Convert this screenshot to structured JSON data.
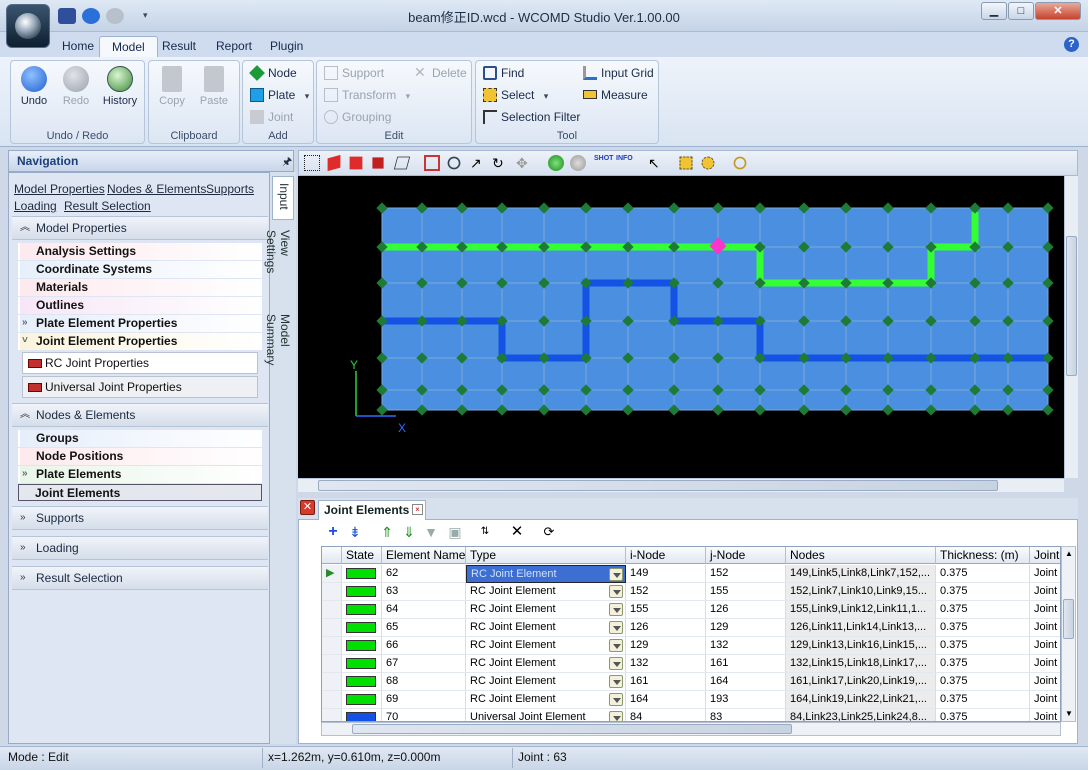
{
  "window": {
    "title": "beam修正ID.wcd - WCOMD Studio Ver.1.00.00",
    "controls": {
      "minimize": "▁",
      "maximize": "□",
      "close": "✕"
    }
  },
  "ribbon": {
    "tabs": [
      "Home",
      "Model",
      "Result",
      "Report",
      "Plugin"
    ],
    "active_tab": "Model",
    "groups": {
      "undo_redo": {
        "label": "Undo / Redo",
        "undo": "Undo",
        "redo": "Redo",
        "history": "History"
      },
      "clipboard": {
        "label": "Clipboard",
        "copy": "Copy",
        "paste": "Paste"
      },
      "add": {
        "label": "Add",
        "node": "Node",
        "plate": "Plate",
        "joint": "Joint"
      },
      "edit": {
        "label": "Edit",
        "support": "Support",
        "delete": "Delete",
        "transform": "Transform",
        "grouping": "Grouping"
      },
      "tool": {
        "label": "Tool",
        "find": "Find",
        "input_grid": "Input Grid",
        "select": "Select",
        "measure": "Measure",
        "selection_filter": "Selection Filter"
      }
    },
    "help": "?"
  },
  "navigation": {
    "title": "Navigation",
    "pin": "🖈",
    "links": [
      "Model Properties",
      "Nodes & Elements",
      "Supports",
      "Loading",
      "Result Selection"
    ],
    "sections": {
      "model_properties": {
        "label": "Model Properties",
        "items": [
          "Analysis Settings",
          "Coordinate Systems",
          "Materials",
          "Outlines",
          "Plate Element Properties",
          "Joint Element Properties"
        ],
        "subitems": [
          "RC Joint Properties",
          "Universal Joint Properties"
        ]
      },
      "nodes_elements": {
        "label": "Nodes & Elements",
        "items": [
          "Groups",
          "Node Positions",
          "Plate Elements",
          "Joint Elements"
        ]
      },
      "supports": {
        "label": "Supports"
      },
      "loading": {
        "label": "Loading"
      },
      "result_selection": {
        "label": "Result Selection"
      }
    },
    "vtabs": [
      "Input",
      "View Settings",
      "Model Summary"
    ]
  },
  "viewport": {
    "axis_y": "Y",
    "axis_x": "X",
    "colors": {
      "plate": "#4a8fe0",
      "rc_joint": "#33ff33",
      "universal_joint": "#1452e6",
      "node": "#1e7a34",
      "selected": "#ff33cc"
    }
  },
  "joint_panel": {
    "tab": "Joint Elements",
    "close": "×",
    "columns": [
      "State",
      "Element Name",
      "Type",
      "i-Node",
      "j-Node",
      "Nodes",
      "Thickness: (m)",
      "Joint Prop"
    ],
    "rows": [
      {
        "name": "62",
        "type": "RC Joint Element",
        "i": "149",
        "j": "152",
        "nodes": "149,Link5,Link8,Link7,152,...",
        "thickness": "0.375",
        "prop": "Joint",
        "state": "#00e000",
        "selected": true
      },
      {
        "name": "63",
        "type": "RC Joint Element",
        "i": "152",
        "j": "155",
        "nodes": "152,Link7,Link10,Link9,15...",
        "thickness": "0.375",
        "prop": "Joint",
        "state": "#00e000"
      },
      {
        "name": "64",
        "type": "RC Joint Element",
        "i": "155",
        "j": "126",
        "nodes": "155,Link9,Link12,Link11,1...",
        "thickness": "0.375",
        "prop": "Joint",
        "state": "#00e000"
      },
      {
        "name": "65",
        "type": "RC Joint Element",
        "i": "126",
        "j": "129",
        "nodes": "126,Link11,Link14,Link13,...",
        "thickness": "0.375",
        "prop": "Joint",
        "state": "#00e000"
      },
      {
        "name": "66",
        "type": "RC Joint Element",
        "i": "129",
        "j": "132",
        "nodes": "129,Link13,Link16,Link15,...",
        "thickness": "0.375",
        "prop": "Joint",
        "state": "#00e000"
      },
      {
        "name": "67",
        "type": "RC Joint Element",
        "i": "132",
        "j": "161",
        "nodes": "132,Link15,Link18,Link17,...",
        "thickness": "0.375",
        "prop": "Joint",
        "state": "#00e000"
      },
      {
        "name": "68",
        "type": "RC Joint Element",
        "i": "161",
        "j": "164",
        "nodes": "161,Link17,Link20,Link19,...",
        "thickness": "0.375",
        "prop": "Joint",
        "state": "#00e000"
      },
      {
        "name": "69",
        "type": "RC Joint Element",
        "i": "164",
        "j": "193",
        "nodes": "164,Link19,Link22,Link21,...",
        "thickness": "0.375",
        "prop": "Joint",
        "state": "#00e000"
      },
      {
        "name": "70",
        "type": "Universal Joint Element",
        "i": "84",
        "j": "83",
        "nodes": "84,Link23,Link25,Link24,8...",
        "thickness": "0.375",
        "prop": "Joint",
        "state": "#1452e6"
      }
    ]
  },
  "statusbar": {
    "mode": "Mode : Edit",
    "coords": "x=1.262m, y=0.610m, z=0.000m",
    "joint": "Joint : 63"
  }
}
